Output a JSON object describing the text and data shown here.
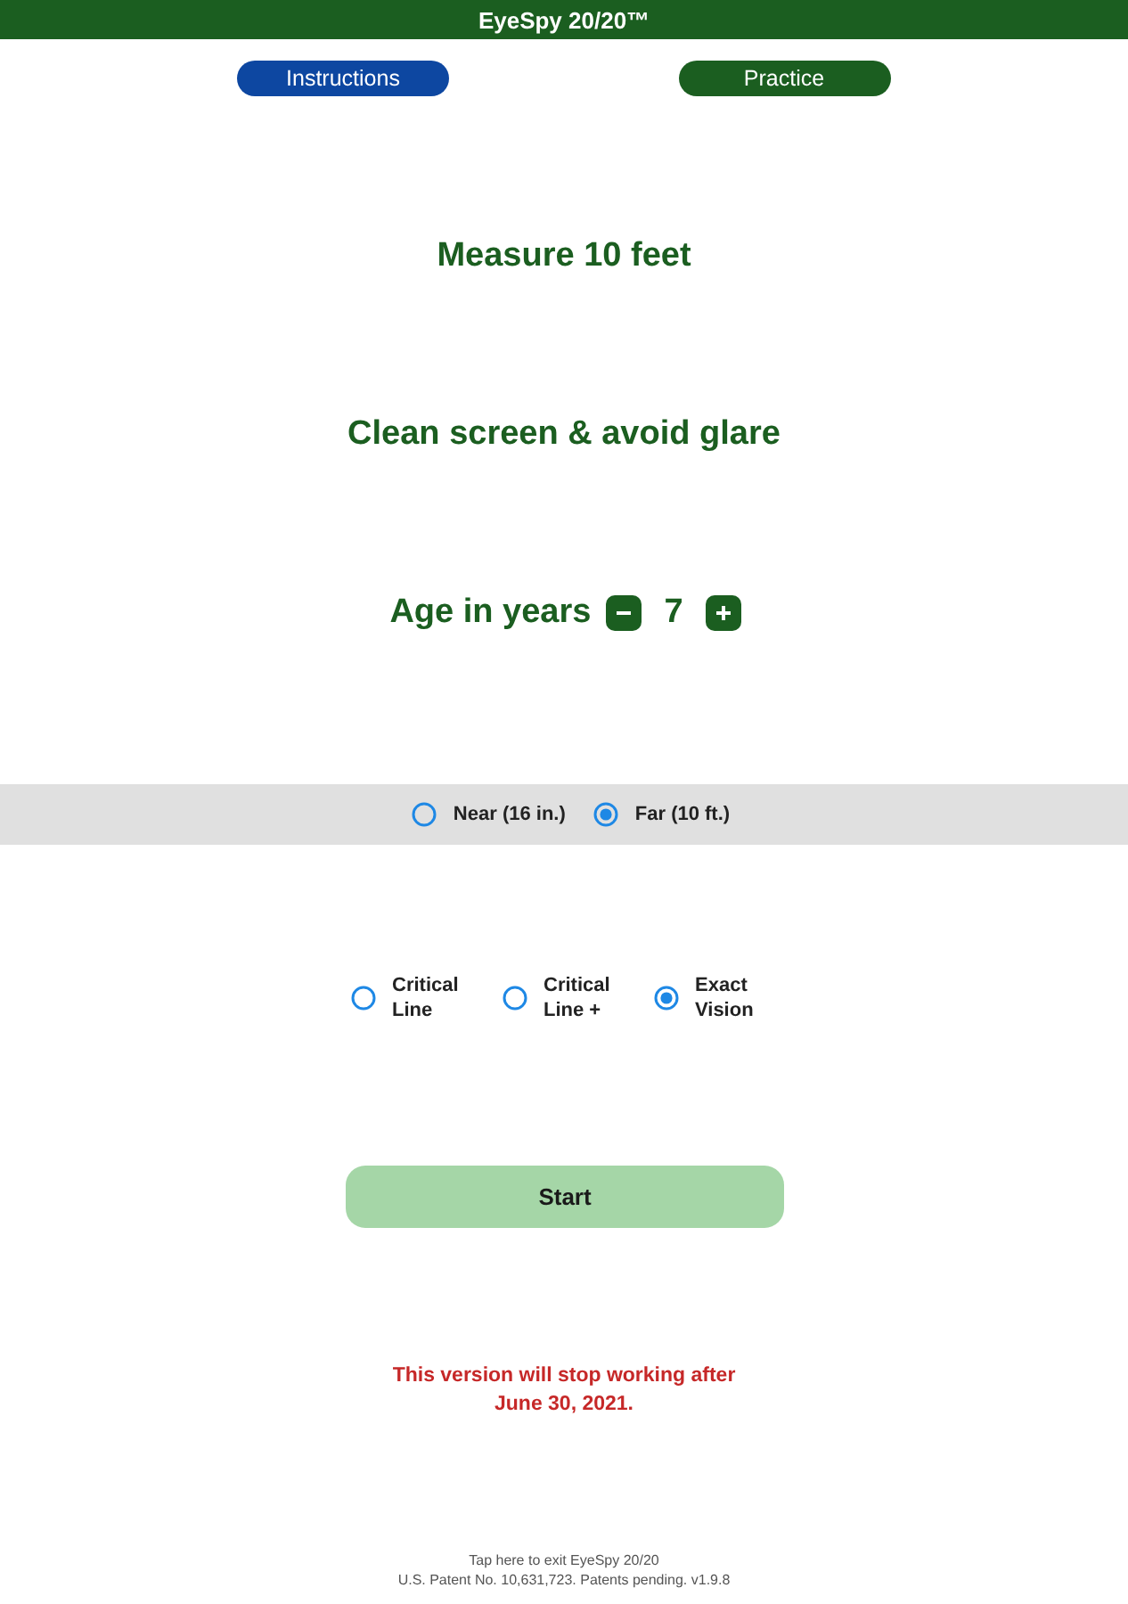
{
  "header": {
    "title": "EyeSpy 20/20™"
  },
  "nav_buttons": [
    {
      "label": "Instructions",
      "color": "#0d47a1"
    },
    {
      "label": "Practice",
      "color": "#1b5e20"
    }
  ],
  "instructions": [
    "Measure 10 feet",
    "Clean screen & avoid glare"
  ],
  "age": {
    "label": "Age in years",
    "value": "7"
  },
  "distance_options": [
    {
      "label": "Near (16 in.)",
      "selected": false
    },
    {
      "label": "Far (10 ft.)",
      "selected": true
    }
  ],
  "test_modes": [
    {
      "label": "Critical Line",
      "selected": false
    },
    {
      "label": "Critical Line +",
      "selected": false
    },
    {
      "label": "Exact Vision",
      "selected": true
    }
  ],
  "start_button": {
    "label": "Start"
  },
  "expiry_notice": "This version will stop working after June 30, 2021.",
  "footer": {
    "exit_link": "Tap here to exit EyeSpy 20/20",
    "patent_note": "U.S. Patent No. 10,631,723. Patents pending. v1.9.8"
  }
}
